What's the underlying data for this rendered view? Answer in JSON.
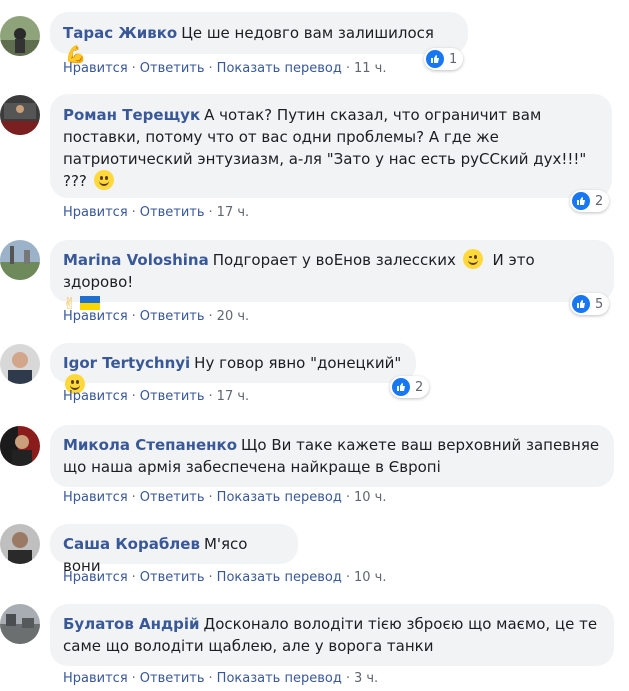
{
  "labels": {
    "like": "Нравится",
    "reply": "Ответить",
    "translate": "Показать перевод"
  },
  "comments": [
    {
      "author": "Тарас Живко",
      "text": "Це ше недовго вам залишилося",
      "time": "11 ч.",
      "likes": "1"
    },
    {
      "author": "Роман Терещук",
      "text": "А чотак? Путин сказал, что ограничит вам поставки, потому что от вас одни проблемы? А где же патриотический энтузиазм, а-ля \"Зато у нас есть руССкий дух!!!\" ???",
      "time": "17 ч.",
      "likes": "2"
    },
    {
      "author": "Marina Voloshina",
      "text": "Подгорает у воЕнов залесских",
      "text2": "И это здорово!",
      "time": "20 ч.",
      "likes": "5"
    },
    {
      "author": "Igor Tertychnyi",
      "text": "Ну говор явно \"донецкий\"",
      "time": "17 ч.",
      "likes": "2"
    },
    {
      "author": "Микола Степаненко",
      "text": "Що Ви таке кажете ваш верховний запевняе що наша армія забеспечена найкраще в Європі",
      "time": "10 ч."
    },
    {
      "author": "Саша Кораблев",
      "text": "М'ясо вони",
      "time": "10 ч."
    },
    {
      "author": "Булатов Андрій",
      "text": "Досконало володіти тією зброєю що маємо, це те саме що володіти щаблею, але у ворога танки",
      "time": "3 ч."
    }
  ],
  "colors": {
    "link": "#385898",
    "bubble": "#f2f3f5",
    "like_badge": "#1877f2",
    "meta": "#606770"
  }
}
